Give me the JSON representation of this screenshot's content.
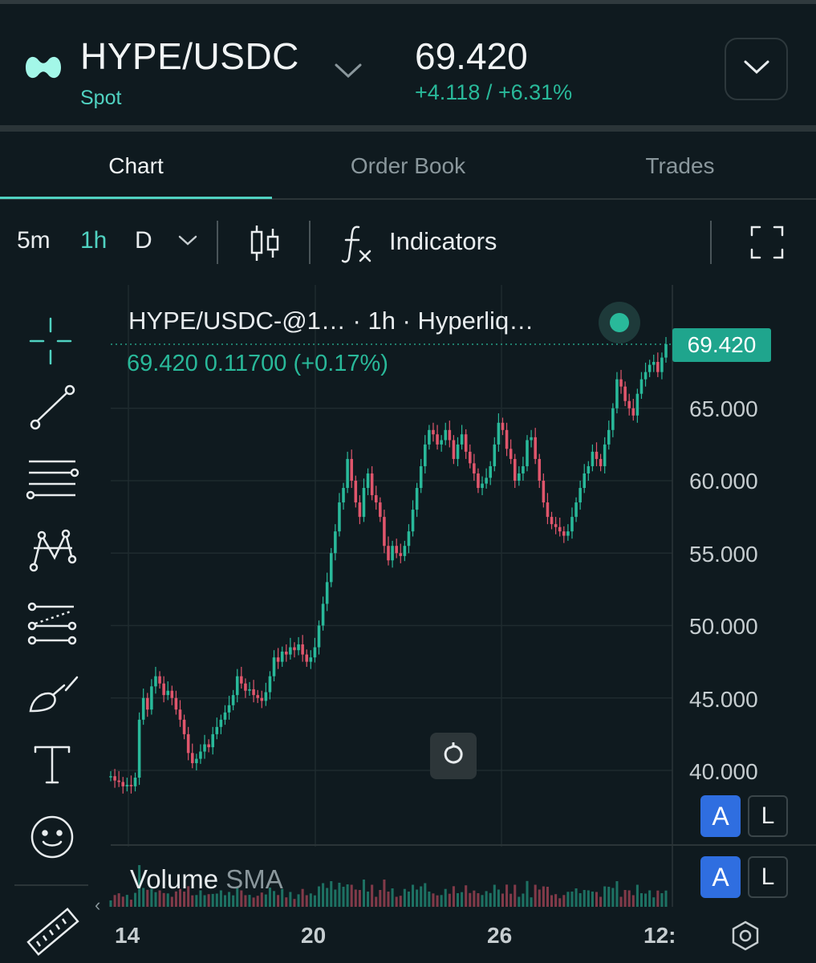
{
  "header": {
    "pair": "HYPE/USDC",
    "market_type": "Spot",
    "last_price": "69.420",
    "change": "+4.118 / +6.31%",
    "logo_icon": "hyperliquid-logo",
    "accent_color": "#50d2c1"
  },
  "tabs": [
    {
      "label": "Chart",
      "active": true
    },
    {
      "label": "Order Book",
      "active": false
    },
    {
      "label": "Trades",
      "active": false
    }
  ],
  "toolbar": {
    "timeframes": [
      {
        "label": "5m",
        "active": false
      },
      {
        "label": "1h",
        "active": true
      },
      {
        "label": "D",
        "active": false
      }
    ],
    "indicators_label": "Indicators"
  },
  "drawing_tools": [
    "crosshair-icon",
    "trend-line-icon",
    "horizontal-lines-icon",
    "pattern-icon",
    "projection-icon",
    "brush-icon",
    "text-icon",
    "emoji-icon",
    "ruler-icon"
  ],
  "chart": {
    "title": "HYPE/USDC-@1…  · 1h · Hyperliq…",
    "ohlc": "69.420  0.11700 (+0.17%)",
    "current_price_tag": "69.420",
    "volume_label": "Volume",
    "volume_sma": "SMA",
    "a_label": "A",
    "l_label": "L",
    "up_color": "#29b99a",
    "down_color": "#e0566c"
  },
  "chart_data": {
    "type": "line",
    "x_ticks": [
      "14",
      "20",
      "26",
      "12:"
    ],
    "y_ticks": [
      "65.000",
      "60.000",
      "55.000",
      "50.000",
      "45.000",
      "40.000"
    ],
    "ylim": [
      38.5,
      70
    ],
    "x": [
      0,
      4,
      8,
      12,
      16,
      20,
      24,
      28,
      32,
      36,
      40,
      44,
      48,
      52,
      56,
      60,
      64,
      68,
      72,
      76,
      80,
      84,
      88,
      92,
      96,
      100,
      104,
      108,
      112,
      116,
      120,
      124,
      128,
      132,
      136,
      140,
      144,
      148,
      152,
      156,
      160,
      164,
      168,
      172,
      176,
      180,
      184,
      188,
      192,
      196,
      200,
      204,
      208,
      212,
      216,
      220,
      224,
      228,
      232,
      236,
      240,
      244,
      248,
      252,
      256,
      260,
      264,
      268,
      272,
      276,
      280,
      284,
      288,
      292,
      296,
      300,
      304,
      308,
      312,
      316,
      320,
      324,
      328,
      332,
      336,
      340,
      344,
      348,
      352,
      356,
      360,
      364,
      368,
      372,
      376,
      380,
      384,
      388,
      392,
      396,
      400,
      404,
      408,
      412,
      416,
      420,
      424,
      428,
      432,
      436,
      440,
      444,
      448,
      452,
      456,
      460,
      464,
      468,
      472,
      476,
      480,
      484,
      488,
      492,
      496,
      500,
      504,
      508,
      512,
      516,
      520,
      524,
      528,
      532,
      536,
      540,
      544,
      548,
      552,
      556,
      560,
      564,
      568,
      572,
      576,
      580,
      584,
      588,
      592,
      596,
      600,
      604,
      608,
      612,
      616,
      620,
      624,
      628,
      632,
      636,
      640,
      644,
      648,
      652,
      656,
      660,
      664,
      668,
      672,
      676,
      680
    ],
    "close": [
      39.6,
      39.3,
      39.2,
      38.9,
      39.0,
      38.9,
      39.5,
      43.5,
      45.0,
      44.2,
      45.8,
      46.5,
      46.0,
      45.2,
      45.5,
      45.0,
      44.2,
      43.5,
      42.5,
      41.2,
      40.5,
      40.8,
      41.3,
      41.8,
      41.6,
      42.5,
      43.0,
      43.5,
      44.0,
      44.5,
      45.2,
      46.5,
      46.0,
      45.5,
      45.6,
      45.2,
      45.0,
      44.8,
      45.4,
      46.5,
      47.8,
      47.5,
      48.2,
      48.0,
      48.5,
      48.3,
      48.7,
      48.0,
      47.5,
      47.8,
      48.5,
      50.0,
      51.5,
      53.0,
      55.0,
      56.5,
      58.5,
      59.5,
      61.5,
      60.0,
      58.5,
      57.5,
      59.5,
      60.5,
      59.0,
      58.5,
      57.5,
      55.5,
      54.5,
      55.5,
      55.0,
      54.8,
      55.5,
      56.5,
      58.0,
      59.5,
      61.0,
      62.5,
      63.5,
      63.2,
      62.5,
      62.8,
      63.5,
      62.8,
      61.5,
      62.5,
      63.2,
      62.0,
      61.2,
      60.5,
      59.5,
      59.8,
      60.2,
      61.0,
      62.5,
      64.0,
      63.5,
      62.2,
      61.5,
      60.0,
      60.5,
      61.0,
      62.8,
      63.0,
      61.5,
      60.0,
      58.5,
      57.5,
      57.0,
      56.8,
      56.5,
      56.2,
      56.5,
      57.5,
      58.5,
      59.5,
      60.5,
      61.0,
      62.0,
      61.5,
      61.0,
      62.5,
      63.5,
      65.0,
      67.0,
      66.5,
      65.5,
      65.0,
      64.5,
      66.0,
      67.0,
      67.5,
      68.0,
      68.2,
      67.5,
      68.5,
      69.42
    ]
  },
  "right_tools": {
    "fullscreen_icon": "fullscreen-icon",
    "settings_icon": "hexagon-settings-icon",
    "reset_icon": "reset-icon"
  }
}
